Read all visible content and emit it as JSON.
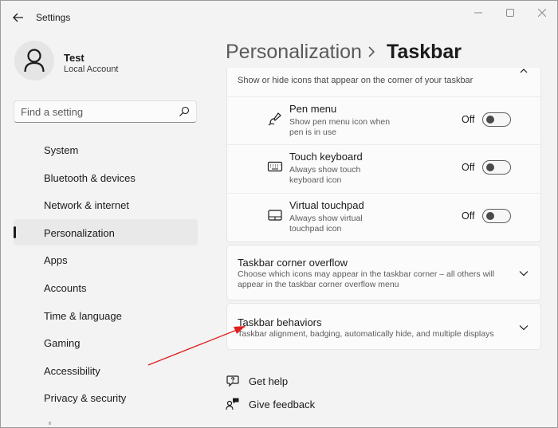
{
  "window": {
    "title": "Settings",
    "controls": [
      "minimize-icon",
      "maximize-icon",
      "close-icon"
    ]
  },
  "profile": {
    "name": "Test",
    "account_type": "Local Account"
  },
  "search": {
    "placeholder": "Find a setting",
    "value": ""
  },
  "sidebar": {
    "items": [
      {
        "label": "System",
        "active": false
      },
      {
        "label": "Bluetooth & devices",
        "active": false
      },
      {
        "label": "Network & internet",
        "active": false
      },
      {
        "label": "Personalization",
        "active": true
      },
      {
        "label": "Apps",
        "active": false
      },
      {
        "label": "Accounts",
        "active": false
      },
      {
        "label": "Time & language",
        "active": false
      },
      {
        "label": "Gaming",
        "active": false
      },
      {
        "label": "Accessibility",
        "active": false
      },
      {
        "label": "Privacy & security",
        "active": false
      }
    ]
  },
  "header": {
    "parent": "Personalization",
    "current": "Taskbar"
  },
  "corner_icons": {
    "description": "Show or hide icons that appear on the corner of your taskbar",
    "rows": [
      {
        "title": "Pen menu",
        "desc_line1": "Show pen menu icon when",
        "desc_line2": "pen is in use",
        "state": "Off",
        "icon": "pen-icon"
      },
      {
        "title": "Touch keyboard",
        "desc_line1": "Always show touch",
        "desc_line2": "keyboard icon",
        "state": "Off",
        "icon": "keyboard-icon"
      },
      {
        "title": "Virtual touchpad",
        "desc_line1": "Always show virtual",
        "desc_line2": "touchpad icon",
        "state": "Off",
        "icon": "touchpad-icon"
      }
    ]
  },
  "overflow": {
    "title": "Taskbar corner overflow",
    "desc_line1": "Choose which icons may appear in the taskbar corner – all others will",
    "desc_line2": "appear in the taskbar corner overflow menu"
  },
  "behaviors": {
    "title": "Taskbar behaviors",
    "desc": "Taskbar alignment, badging, automatically hide, and multiple displays"
  },
  "links": {
    "help": "Get help",
    "feedback": "Give feedback"
  },
  "colors": {
    "annotation_arrow": "#e02020",
    "background": "#f3f3f3",
    "card": "#fbfbfb"
  }
}
